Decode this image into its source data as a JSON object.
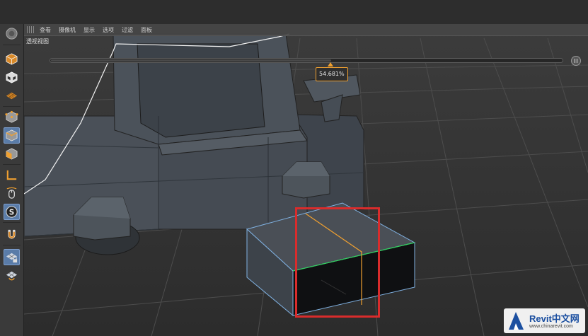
{
  "menubar": {
    "items": [
      "查看",
      "摄像机",
      "显示",
      "选项",
      "过滤",
      "面板"
    ]
  },
  "viewport": {
    "label": "透视视图"
  },
  "slider": {
    "value_label": "54.681%",
    "value_fraction": 0.54681
  },
  "toolbar": {
    "icons": [
      "app-logo-icon",
      "model-mode-icon",
      "texture-mode-icon",
      "workplane-mode-icon",
      "points-mode-icon",
      "edges-mode-icon",
      "polygons-mode-icon",
      "axis-mode-icon",
      "tweak-mode-icon",
      "solo-mode-icon",
      "snap-icon",
      "workplane-lock-icon",
      "planar-workplane-icon"
    ],
    "active_icons": [
      "edges-mode-icon",
      "solo-mode-icon"
    ]
  },
  "watermark": {
    "brand": "Revit中文网",
    "url": "www.chinarevit.com"
  },
  "colors": {
    "accent_orange": "#f0a030",
    "highlight_red": "#d92c2c",
    "selection_blue": "#7fb0e0",
    "edge_green": "#2fd05a",
    "brand_blue": "#1b4fa0"
  }
}
